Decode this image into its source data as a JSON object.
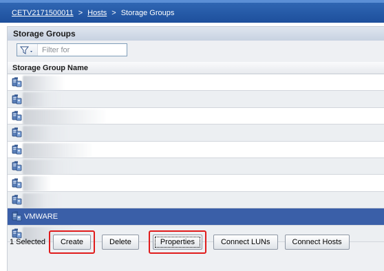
{
  "breadcrumb": {
    "system": "CETV2171500011",
    "sep1": ">",
    "hosts": "Hosts",
    "sep2": ">",
    "current": "Storage Groups"
  },
  "panel": {
    "title": "Storage Groups",
    "filter_placeholder": "Filter for"
  },
  "grid": {
    "column_header": "Storage Group Name",
    "rows": [
      {
        "label": "",
        "selected": false
      },
      {
        "label": "",
        "selected": false
      },
      {
        "label": "",
        "selected": false
      },
      {
        "label": "",
        "selected": false
      },
      {
        "label": "",
        "selected": false
      },
      {
        "label": "",
        "selected": false
      },
      {
        "label": "",
        "selected": false
      },
      {
        "label": "",
        "selected": false
      },
      {
        "label": "VMWARE",
        "selected": true
      },
      {
        "label": "",
        "selected": false
      }
    ]
  },
  "footer": {
    "selected_count": "1 Selected",
    "create": "Create",
    "delete": "Delete",
    "properties": "Properties",
    "connect_luns": "Connect LUNs",
    "connect_hosts": "Connect Hosts"
  },
  "colors": {
    "header_blue": "#1d4f9c",
    "selected_row": "#3a5fa8",
    "highlight_red": "#e01b1b"
  },
  "icons": {
    "filter": "funnel-icon",
    "storage_group": "storage-group-icon"
  }
}
